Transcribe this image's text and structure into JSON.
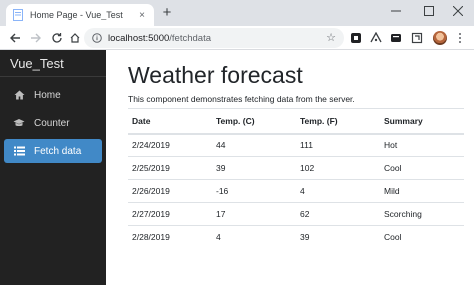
{
  "browser": {
    "tab_title": "Home Page - Vue_Test",
    "tab_close": "×",
    "new_tab": "+",
    "url_host": "localhost:5000",
    "url_path": "/fetchdata",
    "star": "☆",
    "window_controls": [
      "−",
      "☐",
      "✕"
    ]
  },
  "sidebar": {
    "brand": "Vue_Test",
    "items": [
      {
        "label": "Home",
        "icon": "home-icon",
        "active": false
      },
      {
        "label": "Counter",
        "icon": "graduation-cap-icon",
        "active": false
      },
      {
        "label": "Fetch data",
        "icon": "list-icon",
        "active": true
      }
    ]
  },
  "main": {
    "title": "Weather forecast",
    "intro": "This component demonstrates fetching data from the server.",
    "table": {
      "headers": [
        "Date",
        "Temp. (C)",
        "Temp. (F)",
        "Summary"
      ],
      "rows": [
        [
          "2/24/2019",
          "44",
          "111",
          "Hot"
        ],
        [
          "2/25/2019",
          "39",
          "102",
          "Cool"
        ],
        [
          "2/26/2019",
          "-16",
          "4",
          "Mild"
        ],
        [
          "2/27/2019",
          "17",
          "62",
          "Scorching"
        ],
        [
          "2/28/2019",
          "4",
          "39",
          "Cool"
        ]
      ]
    }
  },
  "colors": {
    "sidebar_bg": "#222222",
    "active_item_bg": "#4189c7",
    "tabstrip_bg": "#dee1e6"
  }
}
